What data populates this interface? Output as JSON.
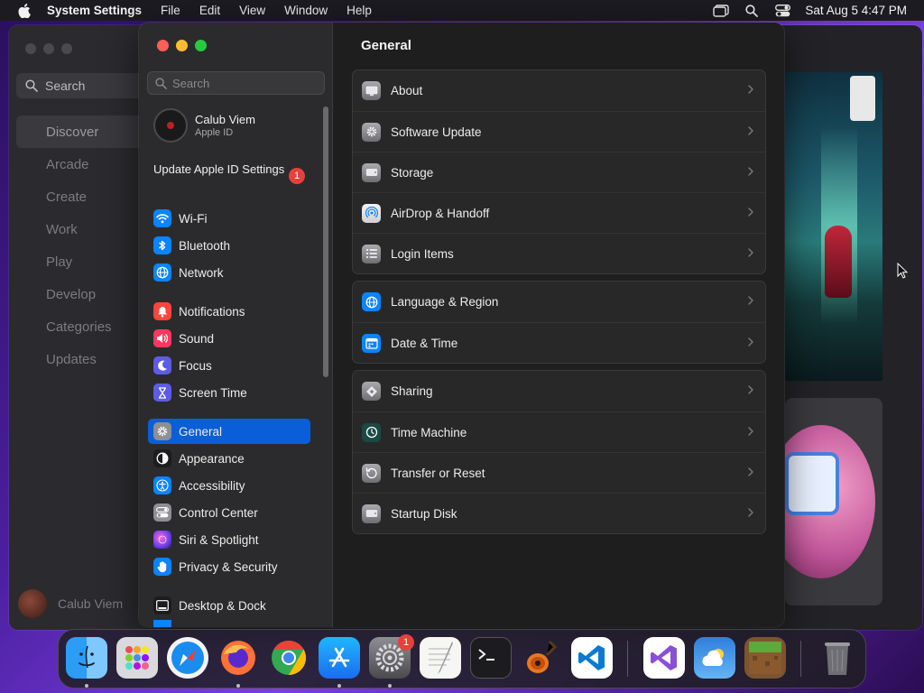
{
  "menubar": {
    "app_name": "System Settings",
    "items": [
      "File",
      "Edit",
      "View",
      "Window",
      "Help"
    ],
    "clock": "Sat Aug 5  4:47 PM"
  },
  "background_app": {
    "search_placeholder": "Search",
    "nav": [
      "Discover",
      "Arcade",
      "Create",
      "Work",
      "Play",
      "Develop",
      "Categories",
      "Updates"
    ],
    "user_name": "Calub Viem"
  },
  "sidebar": {
    "search_placeholder": "Search",
    "account": {
      "name": "Calub Viem",
      "subtitle": "Apple ID"
    },
    "update": {
      "label": "Update Apple ID Settings",
      "badge": "1"
    },
    "items": [
      {
        "label": "Wi-Fi",
        "icon": "wifi-icon",
        "color": "#0a84ff"
      },
      {
        "label": "Bluetooth",
        "icon": "bluetooth-icon",
        "color": "#0a84ff"
      },
      {
        "label": "Network",
        "icon": "globe-icon",
        "color": "#0a84ff"
      },
      {
        "label": "Notifications",
        "icon": "bell-icon",
        "color": "#ff453a"
      },
      {
        "label": "Sound",
        "icon": "speaker-icon",
        "color": "#ff375f"
      },
      {
        "label": "Focus",
        "icon": "moon-icon",
        "color": "#5e5ce6"
      },
      {
        "label": "Screen Time",
        "icon": "hourglass-icon",
        "color": "#5e5ce6"
      },
      {
        "label": "General",
        "icon": "gear-icon",
        "color": "#8e8e93"
      },
      {
        "label": "Appearance",
        "icon": "appearance-icon",
        "color": "#1c1c1e"
      },
      {
        "label": "Accessibility",
        "icon": "accessibility-icon",
        "color": "#0a84ff"
      },
      {
        "label": "Control Center",
        "icon": "control-center-icon",
        "color": "#8e8e93"
      },
      {
        "label": "Siri & Spotlight",
        "icon": "siri-icon",
        "color": "#bf5af2"
      },
      {
        "label": "Privacy & Security",
        "icon": "hand-icon",
        "color": "#0a84ff"
      },
      {
        "label": "Desktop & Dock",
        "icon": "dock-icon",
        "color": "#1c1c1e"
      }
    ],
    "selected": "General"
  },
  "main": {
    "title": "General",
    "groups": [
      [
        {
          "label": "About",
          "icon": "about-icon"
        },
        {
          "label": "Software Update",
          "icon": "software-update-icon"
        },
        {
          "label": "Storage",
          "icon": "storage-icon"
        },
        {
          "label": "AirDrop & Handoff",
          "icon": "airdrop-icon"
        },
        {
          "label": "Login Items",
          "icon": "login-items-icon"
        }
      ],
      [
        {
          "label": "Language & Region",
          "icon": "language-icon"
        },
        {
          "label": "Date & Time",
          "icon": "calendar-icon"
        }
      ],
      [
        {
          "label": "Sharing",
          "icon": "sharing-icon"
        },
        {
          "label": "Time Machine",
          "icon": "time-machine-icon"
        },
        {
          "label": "Transfer or Reset",
          "icon": "reset-icon"
        },
        {
          "label": "Startup Disk",
          "icon": "startup-disk-icon"
        }
      ]
    ]
  },
  "dock": {
    "apps": [
      "Finder",
      "Launchpad",
      "Safari",
      "Firefox",
      "Chrome",
      "App Store",
      "System Settings",
      "TextEdit",
      "Terminal",
      "GarageBand",
      "Visual Studio Code",
      "Visual Studio",
      "Weather",
      "Minecraft",
      "Trash"
    ],
    "settings_badge": "1"
  }
}
